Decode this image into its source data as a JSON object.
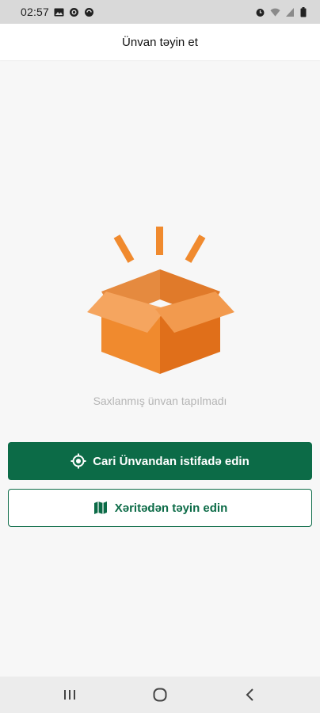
{
  "status_bar": {
    "time": "02:57",
    "icons_left": [
      "gallery-icon",
      "whatsapp-icon",
      "sync-icon"
    ],
    "icons_right": [
      "alarm-icon",
      "wifi-icon",
      "signal-icon",
      "battery-icon"
    ]
  },
  "header": {
    "title": "Ünvan təyin et"
  },
  "empty_state": {
    "icon": "open-box-icon",
    "message": "Saxlanmış ünvan tapılmadı"
  },
  "actions": {
    "current_location_label": "Cari Ünvandan istifadə edin",
    "current_location_icon": "my-location-icon",
    "map_label": "Xəritədən təyin edin",
    "map_icon": "map-icon"
  },
  "colors": {
    "primary": "#0c6b47",
    "box_orange": "#f08a2e",
    "box_dark": "#e07020",
    "box_light": "#f5a55f"
  },
  "nav_bar": {
    "buttons": [
      "recent-apps-icon",
      "home-icon",
      "back-icon"
    ]
  }
}
